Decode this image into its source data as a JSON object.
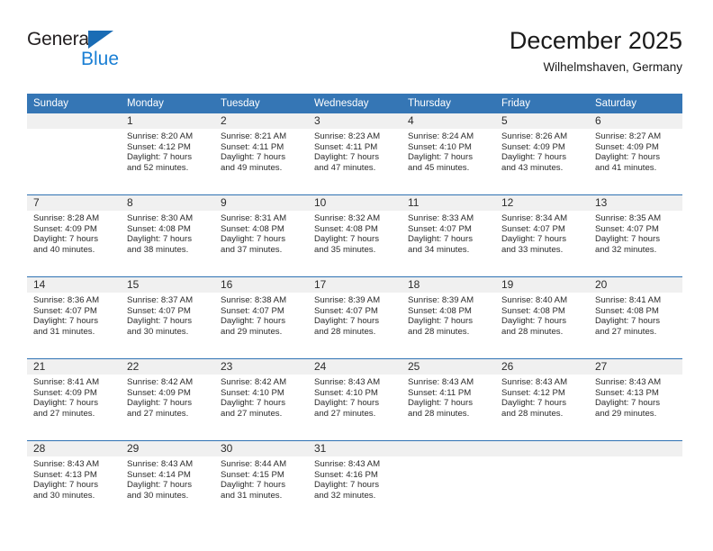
{
  "logo": {
    "word_one": "General",
    "word_two": "Blue",
    "triangle_color": "#1a6cb5",
    "blue_color": "#1a7fd4"
  },
  "header": {
    "title": "December 2025",
    "subtitle": "Wilhelmshaven, Germany"
  },
  "theme": {
    "header_blue": "#3576b5",
    "separator_blue": "#2f72b3",
    "daynum_band": "#f0f0f0",
    "text": "#2b2b2b"
  },
  "weekday_headers": [
    "Sunday",
    "Monday",
    "Tuesday",
    "Wednesday",
    "Thursday",
    "Friday",
    "Saturday"
  ],
  "weeks": [
    [
      {
        "day": "",
        "sunrise": "",
        "sunset": "",
        "daylight_line1": "",
        "daylight_line2": ""
      },
      {
        "day": "1",
        "sunrise": "Sunrise: 8:20 AM",
        "sunset": "Sunset: 4:12 PM",
        "daylight_line1": "Daylight: 7 hours",
        "daylight_line2": "and 52 minutes."
      },
      {
        "day": "2",
        "sunrise": "Sunrise: 8:21 AM",
        "sunset": "Sunset: 4:11 PM",
        "daylight_line1": "Daylight: 7 hours",
        "daylight_line2": "and 49 minutes."
      },
      {
        "day": "3",
        "sunrise": "Sunrise: 8:23 AM",
        "sunset": "Sunset: 4:11 PM",
        "daylight_line1": "Daylight: 7 hours",
        "daylight_line2": "and 47 minutes."
      },
      {
        "day": "4",
        "sunrise": "Sunrise: 8:24 AM",
        "sunset": "Sunset: 4:10 PM",
        "daylight_line1": "Daylight: 7 hours",
        "daylight_line2": "and 45 minutes."
      },
      {
        "day": "5",
        "sunrise": "Sunrise: 8:26 AM",
        "sunset": "Sunset: 4:09 PM",
        "daylight_line1": "Daylight: 7 hours",
        "daylight_line2": "and 43 minutes."
      },
      {
        "day": "6",
        "sunrise": "Sunrise: 8:27 AM",
        "sunset": "Sunset: 4:09 PM",
        "daylight_line1": "Daylight: 7 hours",
        "daylight_line2": "and 41 minutes."
      }
    ],
    [
      {
        "day": "7",
        "sunrise": "Sunrise: 8:28 AM",
        "sunset": "Sunset: 4:09 PM",
        "daylight_line1": "Daylight: 7 hours",
        "daylight_line2": "and 40 minutes."
      },
      {
        "day": "8",
        "sunrise": "Sunrise: 8:30 AM",
        "sunset": "Sunset: 4:08 PM",
        "daylight_line1": "Daylight: 7 hours",
        "daylight_line2": "and 38 minutes."
      },
      {
        "day": "9",
        "sunrise": "Sunrise: 8:31 AM",
        "sunset": "Sunset: 4:08 PM",
        "daylight_line1": "Daylight: 7 hours",
        "daylight_line2": "and 37 minutes."
      },
      {
        "day": "10",
        "sunrise": "Sunrise: 8:32 AM",
        "sunset": "Sunset: 4:08 PM",
        "daylight_line1": "Daylight: 7 hours",
        "daylight_line2": "and 35 minutes."
      },
      {
        "day": "11",
        "sunrise": "Sunrise: 8:33 AM",
        "sunset": "Sunset: 4:07 PM",
        "daylight_line1": "Daylight: 7 hours",
        "daylight_line2": "and 34 minutes."
      },
      {
        "day": "12",
        "sunrise": "Sunrise: 8:34 AM",
        "sunset": "Sunset: 4:07 PM",
        "daylight_line1": "Daylight: 7 hours",
        "daylight_line2": "and 33 minutes."
      },
      {
        "day": "13",
        "sunrise": "Sunrise: 8:35 AM",
        "sunset": "Sunset: 4:07 PM",
        "daylight_line1": "Daylight: 7 hours",
        "daylight_line2": "and 32 minutes."
      }
    ],
    [
      {
        "day": "14",
        "sunrise": "Sunrise: 8:36 AM",
        "sunset": "Sunset: 4:07 PM",
        "daylight_line1": "Daylight: 7 hours",
        "daylight_line2": "and 31 minutes."
      },
      {
        "day": "15",
        "sunrise": "Sunrise: 8:37 AM",
        "sunset": "Sunset: 4:07 PM",
        "daylight_line1": "Daylight: 7 hours",
        "daylight_line2": "and 30 minutes."
      },
      {
        "day": "16",
        "sunrise": "Sunrise: 8:38 AM",
        "sunset": "Sunset: 4:07 PM",
        "daylight_line1": "Daylight: 7 hours",
        "daylight_line2": "and 29 minutes."
      },
      {
        "day": "17",
        "sunrise": "Sunrise: 8:39 AM",
        "sunset": "Sunset: 4:07 PM",
        "daylight_line1": "Daylight: 7 hours",
        "daylight_line2": "and 28 minutes."
      },
      {
        "day": "18",
        "sunrise": "Sunrise: 8:39 AM",
        "sunset": "Sunset: 4:08 PM",
        "daylight_line1": "Daylight: 7 hours",
        "daylight_line2": "and 28 minutes."
      },
      {
        "day": "19",
        "sunrise": "Sunrise: 8:40 AM",
        "sunset": "Sunset: 4:08 PM",
        "daylight_line1": "Daylight: 7 hours",
        "daylight_line2": "and 28 minutes."
      },
      {
        "day": "20",
        "sunrise": "Sunrise: 8:41 AM",
        "sunset": "Sunset: 4:08 PM",
        "daylight_line1": "Daylight: 7 hours",
        "daylight_line2": "and 27 minutes."
      }
    ],
    [
      {
        "day": "21",
        "sunrise": "Sunrise: 8:41 AM",
        "sunset": "Sunset: 4:09 PM",
        "daylight_line1": "Daylight: 7 hours",
        "daylight_line2": "and 27 minutes."
      },
      {
        "day": "22",
        "sunrise": "Sunrise: 8:42 AM",
        "sunset": "Sunset: 4:09 PM",
        "daylight_line1": "Daylight: 7 hours",
        "daylight_line2": "and 27 minutes."
      },
      {
        "day": "23",
        "sunrise": "Sunrise: 8:42 AM",
        "sunset": "Sunset: 4:10 PM",
        "daylight_line1": "Daylight: 7 hours",
        "daylight_line2": "and 27 minutes."
      },
      {
        "day": "24",
        "sunrise": "Sunrise: 8:43 AM",
        "sunset": "Sunset: 4:10 PM",
        "daylight_line1": "Daylight: 7 hours",
        "daylight_line2": "and 27 minutes."
      },
      {
        "day": "25",
        "sunrise": "Sunrise: 8:43 AM",
        "sunset": "Sunset: 4:11 PM",
        "daylight_line1": "Daylight: 7 hours",
        "daylight_line2": "and 28 minutes."
      },
      {
        "day": "26",
        "sunrise": "Sunrise: 8:43 AM",
        "sunset": "Sunset: 4:12 PM",
        "daylight_line1": "Daylight: 7 hours",
        "daylight_line2": "and 28 minutes."
      },
      {
        "day": "27",
        "sunrise": "Sunrise: 8:43 AM",
        "sunset": "Sunset: 4:13 PM",
        "daylight_line1": "Daylight: 7 hours",
        "daylight_line2": "and 29 minutes."
      }
    ],
    [
      {
        "day": "28",
        "sunrise": "Sunrise: 8:43 AM",
        "sunset": "Sunset: 4:13 PM",
        "daylight_line1": "Daylight: 7 hours",
        "daylight_line2": "and 30 minutes."
      },
      {
        "day": "29",
        "sunrise": "Sunrise: 8:43 AM",
        "sunset": "Sunset: 4:14 PM",
        "daylight_line1": "Daylight: 7 hours",
        "daylight_line2": "and 30 minutes."
      },
      {
        "day": "30",
        "sunrise": "Sunrise: 8:44 AM",
        "sunset": "Sunset: 4:15 PM",
        "daylight_line1": "Daylight: 7 hours",
        "daylight_line2": "and 31 minutes."
      },
      {
        "day": "31",
        "sunrise": "Sunrise: 8:43 AM",
        "sunset": "Sunset: 4:16 PM",
        "daylight_line1": "Daylight: 7 hours",
        "daylight_line2": "and 32 minutes."
      },
      {
        "day": "",
        "sunrise": "",
        "sunset": "",
        "daylight_line1": "",
        "daylight_line2": ""
      },
      {
        "day": "",
        "sunrise": "",
        "sunset": "",
        "daylight_line1": "",
        "daylight_line2": ""
      },
      {
        "day": "",
        "sunrise": "",
        "sunset": "",
        "daylight_line1": "",
        "daylight_line2": ""
      }
    ]
  ]
}
